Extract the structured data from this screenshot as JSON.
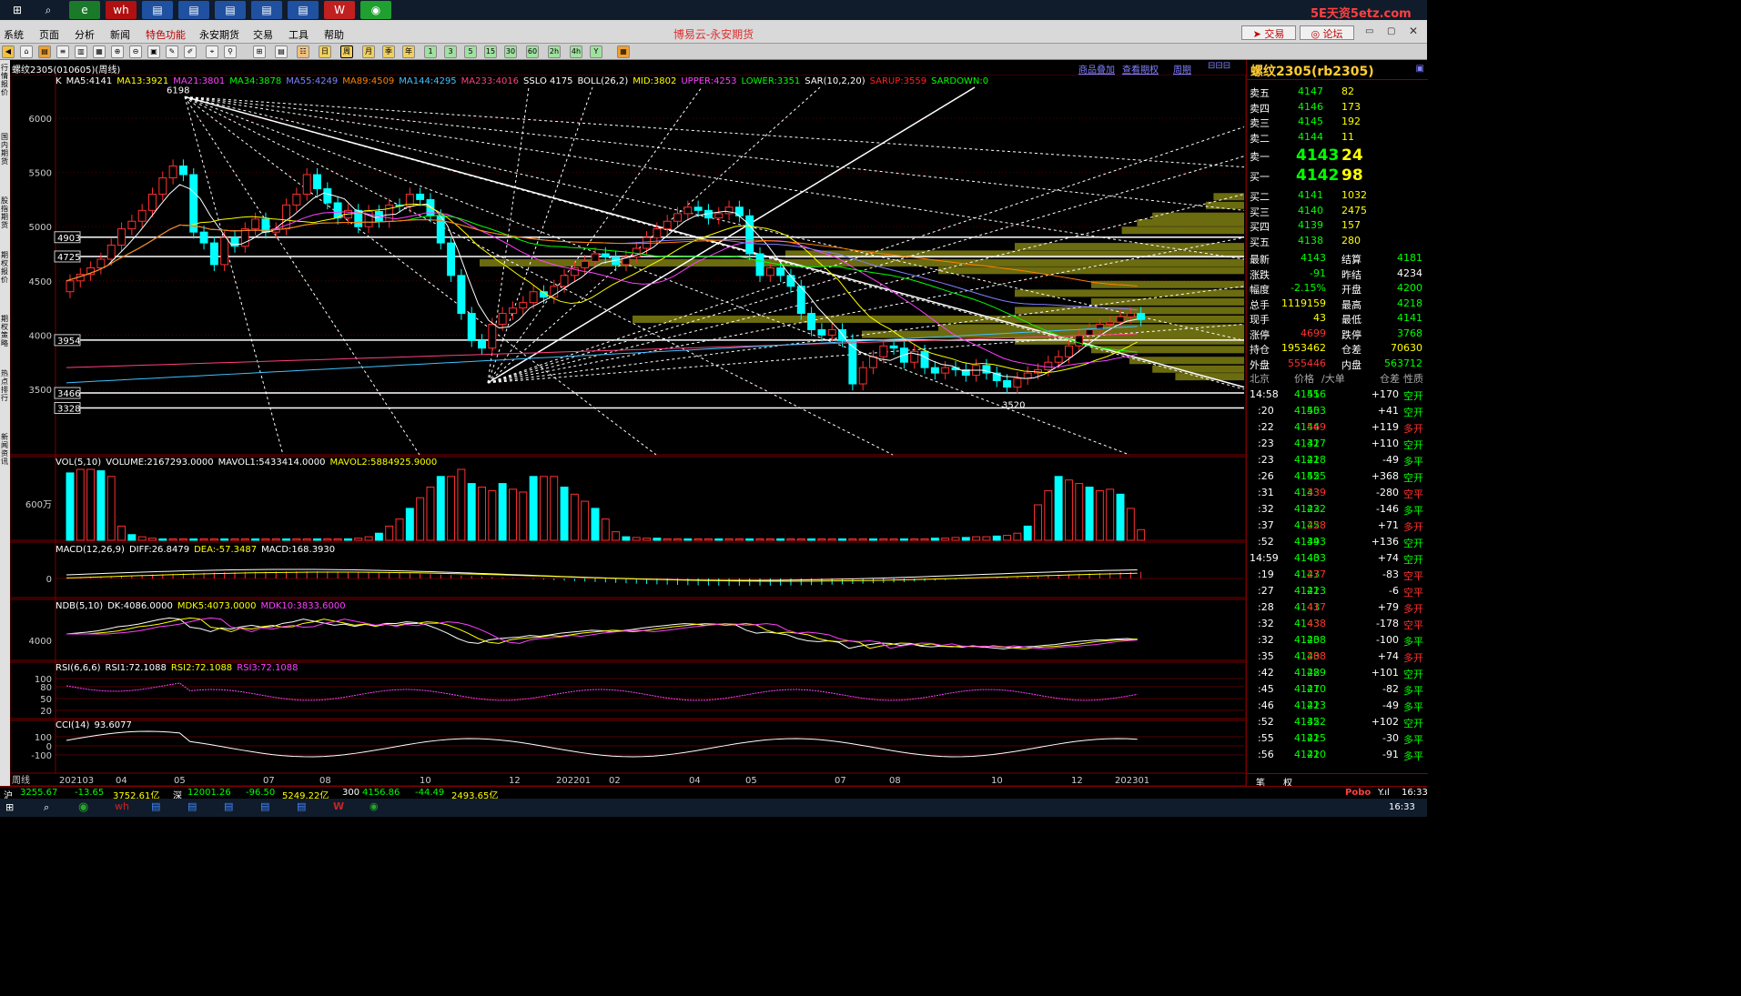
{
  "taskbar_top": {
    "watermark": "5E天资5etz.com"
  },
  "menu": {
    "items": [
      "系统",
      "页面",
      "分析",
      "新闻",
      "特色功能",
      "永安期货",
      "交易",
      "工具",
      "帮助"
    ],
    "app_title": "博易云-永安期货",
    "trade_btn": "交易",
    "forum_btn": "论坛"
  },
  "toolbar": {
    "period_labels": [
      "1",
      "3",
      "5",
      "15",
      "30",
      "60",
      "2h",
      "4h",
      "Y"
    ],
    "day_label": "日",
    "week_label": "周",
    "month_label": "月",
    "quarter_label": "季",
    "year_label": "年"
  },
  "sidebar": {
    "labels": [
      "行情报价",
      "国内期货",
      "股指期货",
      "期权报价",
      "期权策略",
      "热点排行",
      "新闻资讯"
    ]
  },
  "chart": {
    "header_title": "螺纹2305(010605)(周线)",
    "links": [
      "商品叠加",
      "查看期权",
      "周期"
    ],
    "ma_line": [
      {
        "t": "K",
        "c": "#ffffff"
      },
      {
        "t": "MA5:4141",
        "c": "#ffffff"
      },
      {
        "t": "MA13:3921",
        "c": "#ffff00"
      },
      {
        "t": "MA21:3801",
        "c": "#ff40ff"
      },
      {
        "t": "MA34:3878",
        "c": "#00ff00"
      },
      {
        "t": "MA55:4249",
        "c": "#8080ff"
      },
      {
        "t": "MA89:4509",
        "c": "#ff8000"
      },
      {
        "t": "MA144:4295",
        "c": "#40c0ff"
      },
      {
        "t": "MA233:4016",
        "c": "#ff4080"
      },
      {
        "t": "SSLO 4175",
        "c": "#ffffff"
      },
      {
        "t": "BOLL(26,2)",
        "c": "#ffffff"
      },
      {
        "t": "MID:3802",
        "c": "#ffff00"
      },
      {
        "t": "UPPER:4253",
        "c": "#ff40ff"
      },
      {
        "t": "LOWER:3351",
        "c": "#00ff00"
      },
      {
        "t": "SAR(10,2,20)",
        "c": "#ffffff"
      },
      {
        "t": "SARUP:3559",
        "c": "#ff2020"
      },
      {
        "t": "SARDOWN:0",
        "c": "#00ff00"
      }
    ],
    "price_axis": [
      "6000",
      "5500",
      "5000",
      "4500",
      "4000",
      "3500"
    ],
    "box_labels": [
      "4903",
      "4725",
      "3954",
      "3466",
      "3328"
    ],
    "high_label": "6198",
    "low_label": "3520",
    "vol_line": [
      {
        "t": "VOL(5,10)",
        "c": "#ffffff"
      },
      {
        "t": "VOLUME:2167293.0000",
        "c": "#ffffff"
      },
      {
        "t": "MAVOL1:5433414.0000",
        "c": "#ffffff"
      },
      {
        "t": "MAVOL2:5884925.9000",
        "c": "#ffff00"
      }
    ],
    "vol_axis": "600万",
    "macd_line": [
      {
        "t": "MACD(12,26,9)",
        "c": "#ffffff"
      },
      {
        "t": "DIFF:26.8479",
        "c": "#ffffff"
      },
      {
        "t": "DEA:-57.3487",
        "c": "#ffff00"
      },
      {
        "t": "MACD:168.3930",
        "c": "#ffffff"
      }
    ],
    "macd_axis": "0",
    "ndb_line": [
      {
        "t": "NDB(5,10)",
        "c": "#ffffff"
      },
      {
        "t": "DK:4086.0000",
        "c": "#ffffff"
      },
      {
        "t": "MDK5:4073.0000",
        "c": "#ffff00"
      },
      {
        "t": "MDK10:3833.6000",
        "c": "#ff40ff"
      }
    ],
    "ndb_axis": "4000",
    "rsi_line": [
      {
        "t": "RSI(6,6,6)",
        "c": "#ffffff"
      },
      {
        "t": "RSI1:72.1088",
        "c": "#ffffff"
      },
      {
        "t": "RSI2:72.1088",
        "c": "#ffff00"
      },
      {
        "t": "RSI3:72.1088",
        "c": "#ff40ff"
      }
    ],
    "rsi_axis": [
      "100",
      "80",
      "50",
      "20"
    ],
    "cci_line": [
      {
        "t": "CCI(14)",
        "c": "#ffffff"
      },
      {
        "t": "93.6077",
        "c": "#ffffff"
      }
    ],
    "cci_axis": [
      "100",
      "0",
      "-100"
    ],
    "time_axis": [
      "周线",
      "202103",
      "04",
      "05",
      "07",
      "08",
      "10",
      "12",
      "202201",
      "02",
      "04",
      "05",
      "07",
      "08",
      "10",
      "12",
      "202301"
    ]
  },
  "quote": {
    "title": "螺纹2305(rb2305)",
    "asks": [
      {
        "l": "卖五",
        "p": "4147",
        "v": "82"
      },
      {
        "l": "卖四",
        "p": "4146",
        "v": "173"
      },
      {
        "l": "卖三",
        "p": "4145",
        "v": "192"
      },
      {
        "l": "卖二",
        "p": "4144",
        "v": "11"
      },
      {
        "l": "卖一",
        "p": "4143",
        "v": "24"
      }
    ],
    "bids": [
      {
        "l": "买一",
        "p": "4142",
        "v": "98"
      },
      {
        "l": "买二",
        "p": "4141",
        "v": "1032"
      },
      {
        "l": "买三",
        "p": "4140",
        "v": "2475"
      },
      {
        "l": "买四",
        "p": "4139",
        "v": "157"
      },
      {
        "l": "买五",
        "p": "4138",
        "v": "280"
      }
    ],
    "stats": [
      {
        "a": "最新",
        "b": "4143",
        "c": "结算",
        "d": "4181",
        "bc": "#00ff00",
        "dc": "#00ff00"
      },
      {
        "a": "涨跌",
        "b": "-91",
        "c": "昨结",
        "d": "4234",
        "bc": "#00ff00",
        "dc": "#ffffff"
      },
      {
        "a": "幅度",
        "b": "-2.15%",
        "c": "开盘",
        "d": "4200",
        "bc": "#00ff00",
        "dc": "#00ff00"
      },
      {
        "a": "总手",
        "b": "1119159",
        "c": "最高",
        "d": "4218",
        "bc": "#ffff00",
        "dc": "#00ff00"
      },
      {
        "a": "现手",
        "b": "43",
        "c": "最低",
        "d": "4141",
        "bc": "#ffff00",
        "dc": "#00ff00"
      },
      {
        "a": "涨停",
        "b": "4699",
        "c": "跌停",
        "d": "3768",
        "bc": "#ff3030",
        "dc": "#00ff00"
      },
      {
        "a": "持仓",
        "b": "1953462",
        "c": "仓差",
        "d": "70630",
        "bc": "#ffff00",
        "dc": "#ffff00"
      },
      {
        "a": "外盘",
        "b": "555446",
        "c": "内盘",
        "d": "563712",
        "bc": "#ff3030",
        "dc": "#00ff00"
      }
    ],
    "ticks_header": [
      "北京",
      "价格",
      "/大单",
      "仓差",
      "性质"
    ],
    "ticks": [
      {
        "t": "14:58",
        "p": "4145",
        "v": "516",
        "d": "+170",
        "n": "空开",
        "vc": "#00ff00",
        "nc": "#00ff00"
      },
      {
        "t": ":20",
        "p": "4145",
        "v": "503",
        "d": "+41",
        "n": "空开",
        "vc": "#00ff00",
        "nc": "#00ff00"
      },
      {
        "t": ":22",
        "p": "4144",
        "v": "569",
        "d": "+119",
        "n": "多开",
        "vc": "#ff3030",
        "nc": "#ff3030"
      },
      {
        "t": ":23",
        "p": "4142",
        "v": "317",
        "d": "+110",
        "n": "空开",
        "vc": "#00ff00",
        "nc": "#00ff00"
      },
      {
        "t": ":23",
        "p": "4142",
        "v": "218",
        "d": "-49",
        "n": "多平",
        "vc": "#00ff00",
        "nc": "#00ff00"
      },
      {
        "t": ":26",
        "p": "4142",
        "v": "555",
        "d": "+368",
        "n": "空开",
        "vc": "#00ff00",
        "nc": "#00ff00"
      },
      {
        "t": ":31",
        "p": "4143",
        "v": "339",
        "d": "-280",
        "n": "空平",
        "vc": "#ff3030",
        "nc": "#ff3030"
      },
      {
        "t": ":32",
        "p": "4143",
        "v": "222",
        "d": "-146",
        "n": "多平",
        "vc": "#00ff00",
        "nc": "#00ff00"
      },
      {
        "t": ":37",
        "p": "4145",
        "v": "228",
        "d": "+71",
        "n": "多开",
        "vc": "#ff3030",
        "nc": "#ff3030"
      },
      {
        "t": ":52",
        "p": "4144",
        "v": "393",
        "d": "+136",
        "n": "空开",
        "vc": "#00ff00",
        "nc": "#00ff00"
      },
      {
        "t": "14:59",
        "p": "4143",
        "v": "403",
        "d": "+74",
        "n": "空开",
        "vc": "#00ff00",
        "nc": "#00ff00"
      },
      {
        "t": ":19",
        "p": "4143",
        "v": "277",
        "d": "-83",
        "n": "空平",
        "vc": "#ff3030",
        "nc": "#ff3030"
      },
      {
        "t": ":27",
        "p": "4142",
        "v": "213",
        "d": "-6",
        "n": "空平",
        "vc": "#00ff00",
        "nc": "#ff3030"
      },
      {
        "t": ":28",
        "p": "4143",
        "v": "417",
        "d": "+79",
        "n": "多开",
        "vc": "#ff3030",
        "nc": "#ff3030"
      },
      {
        "t": ":32",
        "p": "4143",
        "v": "438",
        "d": "-178",
        "n": "空平",
        "vc": "#ff3030",
        "nc": "#ff3030"
      },
      {
        "t": ":32",
        "p": "4143",
        "v": "208",
        "d": "-100",
        "n": "多平",
        "vc": "#00ff00",
        "nc": "#00ff00"
      },
      {
        "t": ":35",
        "p": "4143",
        "v": "208",
        "d": "+74",
        "n": "多开",
        "vc": "#ff3030",
        "nc": "#ff3030"
      },
      {
        "t": ":42",
        "p": "4142",
        "v": "289",
        "d": "+101",
        "n": "空开",
        "vc": "#00ff00",
        "nc": "#00ff00"
      },
      {
        "t": ":45",
        "p": "4141",
        "v": "270",
        "d": "-82",
        "n": "多平",
        "vc": "#00ff00",
        "nc": "#00ff00"
      },
      {
        "t": ":46",
        "p": "4141",
        "v": "223",
        "d": "-49",
        "n": "多平",
        "vc": "#00ff00",
        "nc": "#00ff00"
      },
      {
        "t": ":52",
        "p": "4142",
        "v": "352",
        "d": "+102",
        "n": "空开",
        "vc": "#00ff00",
        "nc": "#00ff00"
      },
      {
        "t": ":55",
        "p": "4141",
        "v": "225",
        "d": "-30",
        "n": "多平",
        "vc": "#00ff00",
        "nc": "#00ff00"
      },
      {
        "t": ":56",
        "p": "4141",
        "v": "220",
        "d": "-91",
        "n": "多平",
        "vc": "#00ff00",
        "nc": "#00ff00"
      }
    ],
    "tabs": [
      "笔",
      "权"
    ]
  },
  "bottom_bar": {
    "items": [
      {
        "t": "沪",
        "c": "#ffffff"
      },
      {
        "t": "3255.67",
        "c": "#00ff00"
      },
      {
        "t": "-13.65",
        "c": "#00ff00"
      },
      {
        "t": "3752.61亿",
        "c": "#ffff00"
      },
      {
        "t": "深",
        "c": "#ffffff"
      },
      {
        "t": "12001.26",
        "c": "#00ff00"
      },
      {
        "t": "-96.50",
        "c": "#00ff00"
      },
      {
        "t": "5249.22亿",
        "c": "#ffff00"
      },
      {
        "t": "300",
        "c": "#ffffff"
      },
      {
        "t": "4156.86",
        "c": "#00ff00"
      },
      {
        "t": "-44.49",
        "c": "#00ff00"
      },
      {
        "t": "2493.65亿",
        "c": "#ffff00"
      }
    ],
    "brand": "Pobo",
    "time": "16:33"
  },
  "win_taskbar": {
    "clock": "16:33"
  }
}
